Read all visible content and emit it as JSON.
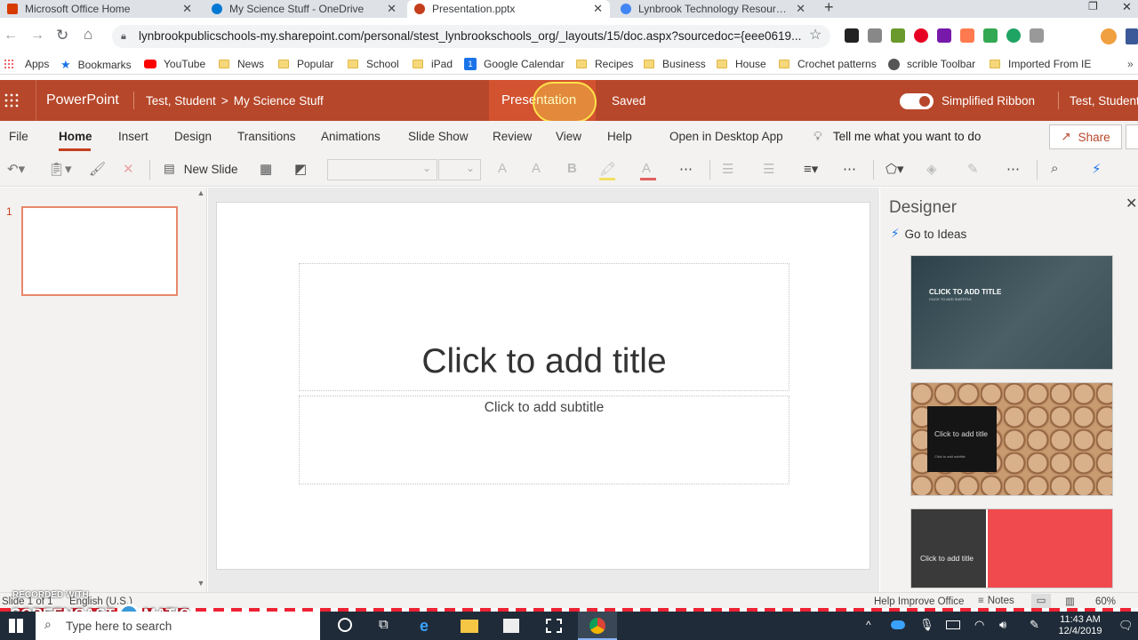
{
  "browser": {
    "tabs": [
      {
        "label": "Microsoft Office Home",
        "color": "#d83b01"
      },
      {
        "label": "My Science Stuff - OneDrive",
        "color": "#0078d4"
      },
      {
        "label": "Presentation.pptx",
        "color": "#c43e1c"
      },
      {
        "label": "Lynbrook Technology Resources",
        "color": "#4285f4"
      }
    ],
    "new_tab_label": "+",
    "url": "lynbrookpublicschools-my.sharepoint.com/personal/stest_lynbrookschools_org/_layouts/15/doc.aspx?sourcedoc={eee0619..."
  },
  "bookmarks": [
    {
      "label": "Apps",
      "icon": "apps-grid"
    },
    {
      "label": "Bookmarks",
      "icon": "star"
    },
    {
      "label": "YouTube",
      "icon": "youtube"
    },
    {
      "label": "News",
      "icon": "folder"
    },
    {
      "label": "Popular",
      "icon": "folder"
    },
    {
      "label": "School",
      "icon": "folder"
    },
    {
      "label": "iPad",
      "icon": "folder"
    },
    {
      "label": "Google Calendar",
      "icon": "calendar"
    },
    {
      "label": "Recipes",
      "icon": "folder"
    },
    {
      "label": "Business",
      "icon": "folder"
    },
    {
      "label": "House",
      "icon": "folder"
    },
    {
      "label": "Crochet patterns",
      "icon": "folder"
    },
    {
      "label": "scrible Toolbar",
      "icon": "globe"
    },
    {
      "label": "Imported From IE",
      "icon": "folder"
    }
  ],
  "office": {
    "app_name": "PowerPoint",
    "owner": "Test, Student",
    "separator": ">",
    "folder": "My Science Stuff",
    "doc_name": "Presentation",
    "save_state": "Saved",
    "simplified_ribbon": "Simplified Ribbon",
    "user": "Test, Student"
  },
  "ribbon_tabs": [
    "File",
    "Home",
    "Insert",
    "Design",
    "Transitions",
    "Animations",
    "Slide Show",
    "Review",
    "View",
    "Help",
    "Open in Desktop App"
  ],
  "tell_me": "Tell me what you want to do",
  "share_label": "Share",
  "toolbar": {
    "new_slide": "New Slide"
  },
  "slide_number": "1",
  "slide": {
    "title_placeholder": "Click to add title",
    "subtitle_placeholder": "Click to add subtitle"
  },
  "designer": {
    "title": "Designer",
    "go_to_ideas": "Go to Ideas",
    "ideas": [
      {
        "title": "CLICK TO ADD TITLE",
        "subtitle": "CLICK TO ADD SUBTITLE"
      },
      {
        "title": "Click to add title",
        "subtitle": "Click to add subtitle"
      },
      {
        "title": "Click to add title",
        "subtitle": ""
      }
    ]
  },
  "status": {
    "slide_of": "Slide 1 of 1",
    "language": "English (U.S.)",
    "help_improve": "Help Improve Office",
    "notes": "Notes",
    "zoom": "60%"
  },
  "watermark": {
    "line1": "RECORDED WITH",
    "line2": "SCREENCAST",
    "line3": "MATIC"
  },
  "taskbar": {
    "search_placeholder": "Type here to search",
    "time": "11:43 AM",
    "date": "12/4/2019"
  }
}
